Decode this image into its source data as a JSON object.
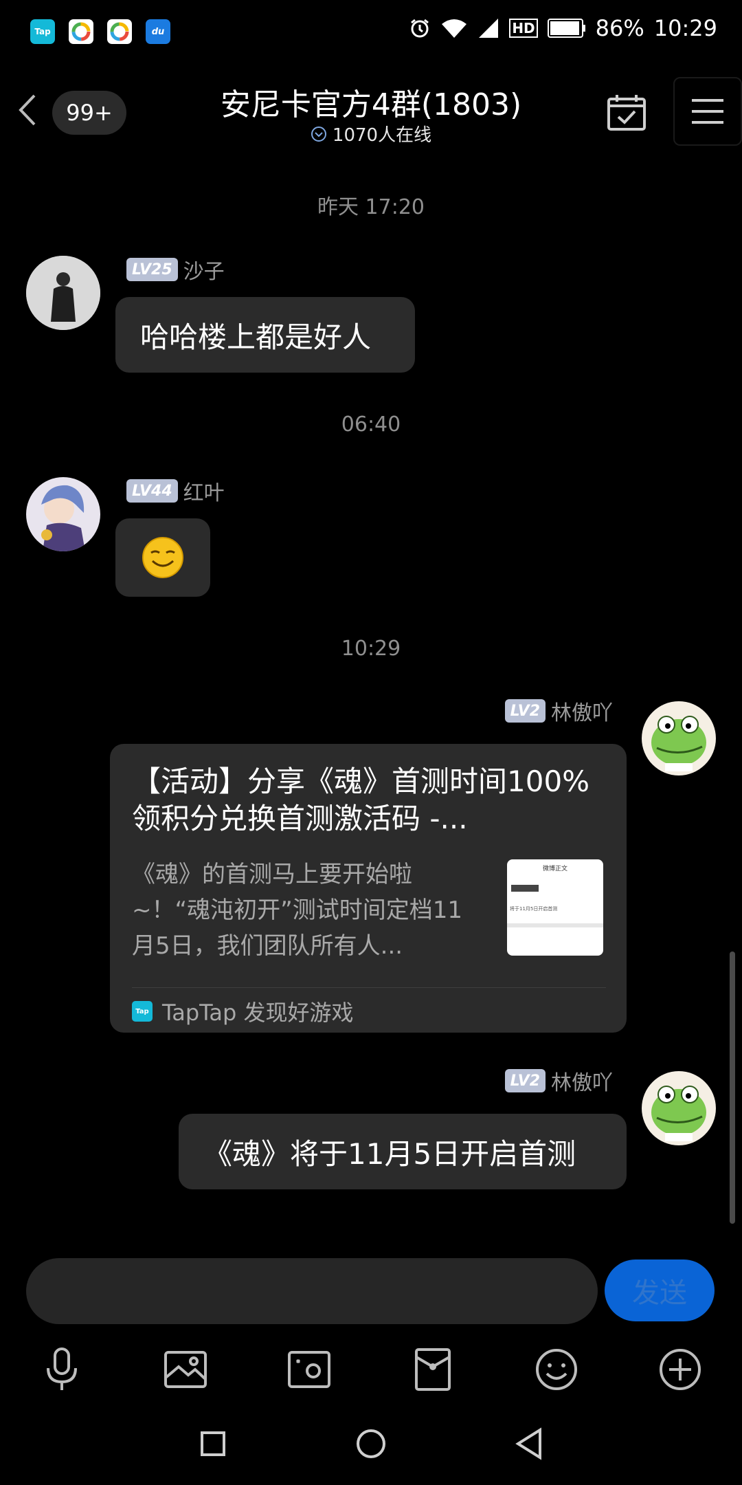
{
  "status_bar": {
    "apps": [
      "Tap",
      "du"
    ],
    "battery": "86%",
    "time": "10:29",
    "network": "HD"
  },
  "header": {
    "unread_count": "99+",
    "title": "安尼卡官方4群(1803)",
    "online": "1070人在线"
  },
  "messages": {
    "ts1": "昨天 17:20",
    "m1": {
      "level": "LV25",
      "name": "沙子",
      "text": "哈哈楼上都是好人"
    },
    "ts2": "06:40",
    "m2": {
      "level": "LV44",
      "name": "红叶",
      "emoji": "😊"
    },
    "ts3": "10:29",
    "m3": {
      "level": "LV2",
      "name": "林傲吖",
      "card": {
        "title": "【活动】分享《魂》首测时间100%领积分兑换首测激活码 -...",
        "desc": "《魂》的首测马上要开始啦~！“魂沌初开”测试时间定档11月5日，我们团队所有人...",
        "thumb_heading": "微博正文",
        "thumb_line": "将于11月5日开启首测",
        "source_logo": "Tap",
        "source": "TapTap 发现好游戏"
      }
    },
    "m4": {
      "level": "LV2",
      "name": "林傲吖",
      "text": "《魂》将于11月5日开启首测"
    }
  },
  "input": {
    "placeholder": "",
    "send_label": "发送"
  },
  "colors": {
    "accent": "#0a64d6",
    "bubble": "#2b2b2b",
    "background": "#000000"
  }
}
